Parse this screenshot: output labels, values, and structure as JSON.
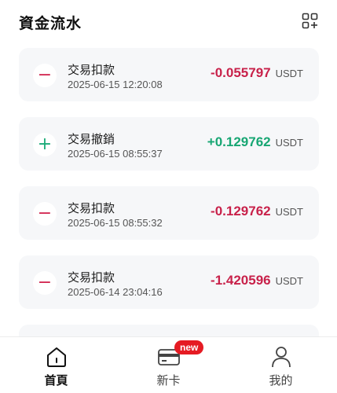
{
  "header": {
    "title": "資金流水",
    "grid_icon": "grid-add-icon"
  },
  "transactions": [
    {
      "type": "debit",
      "sign_icon": "minus-icon",
      "title": "交易扣款",
      "time": "2025-06-15 12:20:08",
      "amount": "-0.055797",
      "unit": "USDT"
    },
    {
      "type": "credit",
      "sign_icon": "plus-icon",
      "title": "交易撤銷",
      "time": "2025-06-15 08:55:37",
      "amount": "+0.129762",
      "unit": "USDT"
    },
    {
      "type": "debit",
      "sign_icon": "minus-icon",
      "title": "交易扣款",
      "time": "2025-06-15 08:55:32",
      "amount": "-0.129762",
      "unit": "USDT"
    },
    {
      "type": "debit",
      "sign_icon": "minus-icon",
      "title": "交易扣款",
      "time": "2025-06-14 23:04:16",
      "amount": "-1.420596",
      "unit": "USDT"
    }
  ],
  "tabbar": {
    "tabs": [
      {
        "label": "首頁",
        "icon": "home-icon",
        "active": true
      },
      {
        "label": "新卡",
        "icon": "card-icon",
        "badge": "new"
      },
      {
        "label": "我的",
        "icon": "profile-icon"
      }
    ]
  },
  "colors": {
    "negative": "#c8214a",
    "positive": "#17a673",
    "badge": "#e51b23",
    "card_bg": "#f6f7f9"
  }
}
